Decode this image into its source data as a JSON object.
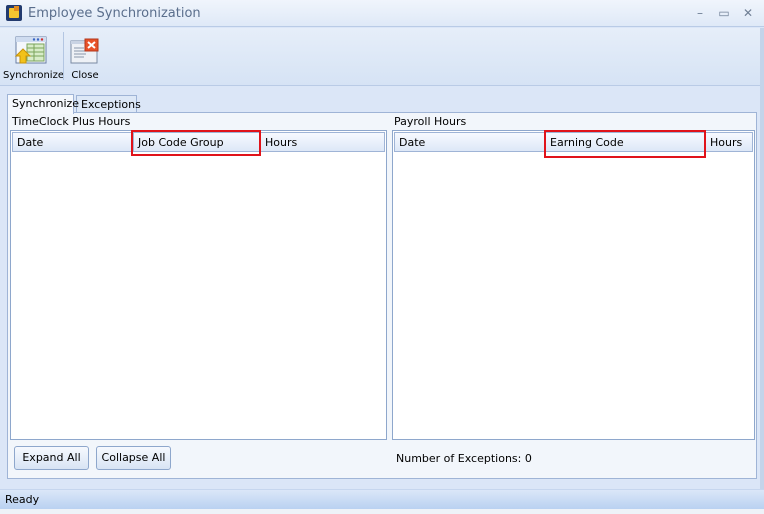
{
  "window": {
    "title": "Employee Synchronization",
    "controls": {
      "minimize": "–",
      "maximize": "▭",
      "close": "✕"
    }
  },
  "toolbar": {
    "synchronize_label": "Synchronize",
    "close_label": "Close"
  },
  "tabs": [
    {
      "label": "Synchronize",
      "active": true
    },
    {
      "label": "Exceptions",
      "active": false
    }
  ],
  "left_panel": {
    "title": "TimeClock Plus Hours",
    "columns": [
      "Date",
      "Job Code Group",
      "Hours"
    ],
    "rows": []
  },
  "right_panel": {
    "title": "Payroll Hours",
    "columns": [
      "Date",
      "Earning Code",
      "Hours"
    ],
    "rows": []
  },
  "buttons": {
    "expand_all": "Expand All",
    "collapse_all": "Collapse All"
  },
  "exceptions_count_text": "Number of Exceptions: 0",
  "status": "Ready",
  "highlight_color": "#e0131a"
}
